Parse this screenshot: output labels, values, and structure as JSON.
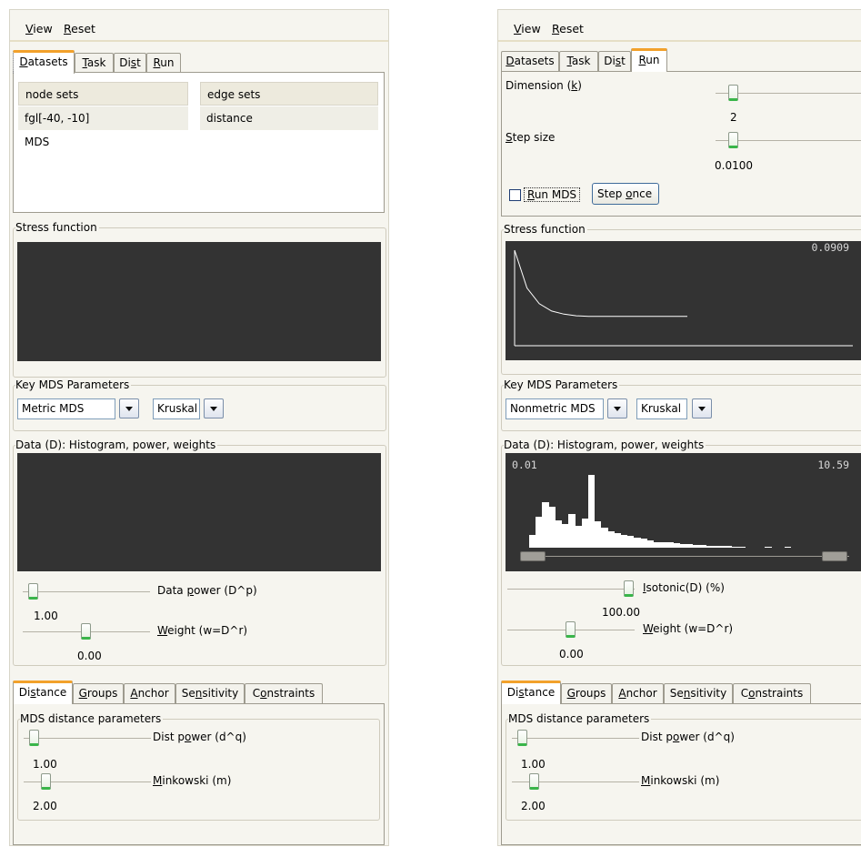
{
  "left": {
    "menu": [
      "View",
      "Reset"
    ],
    "tabs": [
      {
        "pre": "",
        "key": "D",
        "post": "atasets"
      },
      {
        "pre": "",
        "key": "T",
        "post": "ask"
      },
      {
        "pre": "Di",
        "key": "s",
        "post": "t"
      },
      {
        "pre": "",
        "key": "R",
        "post": "un"
      }
    ],
    "datasets": {
      "headers": [
        "node sets",
        "edge sets"
      ],
      "node_sets": [
        "fgl[-40, -10]",
        "MDS"
      ],
      "edge_sets": [
        "distance"
      ]
    },
    "stress_title": "Stress function",
    "key_params_title": "Key MDS Parameters",
    "mds_type": "Metric MDS",
    "stress_type": "Kruskal",
    "data_title": "Data (D): Histogram, power, weights",
    "data_power": {
      "value": "1.00",
      "pre": "Data ",
      "key": "p",
      "post": "ower (D^p)",
      "level": 0.05
    },
    "weight": {
      "value": "0.00",
      "pre": "",
      "key": "W",
      "post": "eight (w=D^r)",
      "level": 0.5
    },
    "bottom_tabs": [
      {
        "pre": "Di",
        "key": "s",
        "post": "tance"
      },
      {
        "pre": "",
        "key": "G",
        "post": "roups"
      },
      {
        "pre": "",
        "key": "A",
        "post": "nchor"
      },
      {
        "pre": "Se",
        "key": "n",
        "post": "sitivity"
      },
      {
        "pre": "C",
        "key": "o",
        "post": "nstraints"
      }
    ],
    "dist_params_title": "MDS distance parameters",
    "dist_power": {
      "value": "1.00",
      "pre": "Dist p",
      "key": "o",
      "post": "wer (d^q)",
      "level": 0.05
    },
    "minkowski": {
      "value": "2.00",
      "pre": "",
      "key": "M",
      "post": "inkowski (m)",
      "level": 0.15
    }
  },
  "right": {
    "menu": [
      "View",
      "Reset"
    ],
    "tabs": [
      {
        "pre": "",
        "key": "D",
        "post": "atasets"
      },
      {
        "pre": "",
        "key": "T",
        "post": "ask"
      },
      {
        "pre": "Di",
        "key": "s",
        "post": "t"
      },
      {
        "pre": "",
        "key": "R",
        "post": "un"
      }
    ],
    "run": {
      "dimension": {
        "pre": "Dimension (",
        "key": "k",
        "post": ")",
        "value": "2"
      },
      "step_size": {
        "pre": "",
        "key": "S",
        "post": "tep size",
        "value": "0.0100"
      },
      "run_mds": {
        "pre": "",
        "key": "R",
        "post": "un MDS"
      },
      "step_once": {
        "pre": "Step ",
        "key": "o",
        "post": "nce"
      }
    },
    "stress_title": "Stress function",
    "stress_value": "0.0909",
    "key_params_title": "Key MDS Parameters",
    "mds_type": "Nonmetric MDS",
    "stress_type": "Kruskal",
    "data_title": "Data (D): Histogram, power, weights",
    "hist_min": "0.01",
    "hist_max": "10.59",
    "isotonic": {
      "value": "100.00",
      "pre": "",
      "key": "I",
      "post": "sotonic(D) (%)",
      "level": 1.0
    },
    "weight": {
      "value": "0.00",
      "pre": "",
      "key": "W",
      "post": "eight (w=D^r)",
      "level": 0.5
    },
    "bottom_tabs": [
      {
        "pre": "Di",
        "key": "s",
        "post": "tance"
      },
      {
        "pre": "",
        "key": "G",
        "post": "roups"
      },
      {
        "pre": "",
        "key": "A",
        "post": "nchor"
      },
      {
        "pre": "Se",
        "key": "n",
        "post": "sitivity"
      },
      {
        "pre": "C",
        "key": "o",
        "post": "nstraints"
      }
    ],
    "dist_params_title": "MDS distance parameters",
    "dist_power": {
      "value": "1.00",
      "pre": "Dist p",
      "key": "o",
      "post": "wer (d^q)",
      "level": 0.05
    },
    "minkowski": {
      "value": "2.00",
      "pre": "",
      "key": "M",
      "post": "inkowski (m)",
      "level": 0.15
    }
  },
  "chart_data": [
    {
      "type": "line",
      "panel": "right-stress",
      "values": [
        0.0909,
        0.055,
        0.04,
        0.033,
        0.03,
        0.0285,
        0.028,
        0.028,
        0.028,
        0.028,
        0.028,
        0.028,
        0.028,
        0.028,
        0.028
      ],
      "ylim": [
        0,
        0.0909
      ],
      "ylabel": "0.0909"
    },
    {
      "type": "bar",
      "panel": "right-histogram",
      "xlim": [
        0.01,
        10.59
      ],
      "values": [
        0.18,
        0.42,
        0.62,
        0.56,
        0.38,
        0.32,
        0.46,
        0.3,
        0.4,
        1.0,
        0.36,
        0.28,
        0.22,
        0.2,
        0.18,
        0.16,
        0.14,
        0.12,
        0.1,
        0.08,
        0.07,
        0.07,
        0.06,
        0.05,
        0.05,
        0.04,
        0.04,
        0.03,
        0.03,
        0.02,
        0.02,
        0.015,
        0.015,
        0.0,
        0.0,
        0.0,
        0.01,
        0.0,
        0.0,
        0.01
      ]
    }
  ]
}
